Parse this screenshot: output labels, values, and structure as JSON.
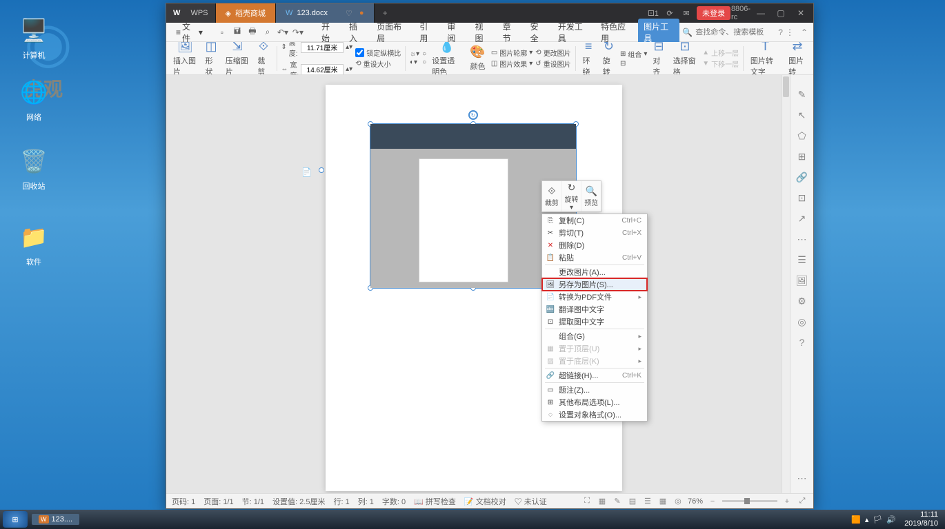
{
  "desktop": {
    "icons": {
      "computer": "计算机",
      "network": "网络",
      "recycle": "回收站",
      "software": "软件"
    },
    "watermark_text": "虎观"
  },
  "taskbar": {
    "app": "123....",
    "time": "11:11",
    "date": "2019/8/10"
  },
  "titlebar": {
    "wps": "WPS",
    "tab_store": "稻壳商城",
    "tab_doc": "123.docx",
    "login": "未登录",
    "version": "8806-rc"
  },
  "menubar": {
    "file": "文件",
    "search_placeholder": "查找命令、搜索模板",
    "tabs": [
      "开始",
      "插入",
      "页面布局",
      "引用",
      "审阅",
      "视图",
      "章节",
      "安全",
      "开发工具",
      "特色应用",
      "图片工具"
    ]
  },
  "ribbon": {
    "insert_img": "插入图片",
    "shape": "形状",
    "compress": "压缩图片",
    "crop": "裁剪",
    "height_lbl": "高度:",
    "height_val": "11.71厘米",
    "width_lbl": "宽度:",
    "width_val": "14.62厘米",
    "lock_ratio": "锁定纵横比",
    "reset_size": "重设大小",
    "set_transparent": "设置透明色",
    "color": "颜色",
    "pic_outline": "图片轮廓",
    "pic_effect": "图片效果",
    "change_pic": "更改图片",
    "reset_pic": "重设图片",
    "wrap": "环绕",
    "rotate": "旋转",
    "combo": "组合",
    "align": "对齐",
    "select_pane": "选择窗格",
    "up_layer": "上移一层",
    "down_layer": "下移一层",
    "pic_to_text": "图片转文字",
    "pic_trans": "图片转"
  },
  "mini_toolbar": {
    "crop": "裁剪",
    "rotate": "旋转",
    "preview": "预览"
  },
  "context_menu": [
    {
      "label": "复制(C)",
      "shortcut": "Ctrl+C",
      "icon": "⎘"
    },
    {
      "label": "剪切(T)",
      "shortcut": "Ctrl+X",
      "icon": "✂"
    },
    {
      "label": "删除(D)",
      "icon": "✕",
      "red": true
    },
    {
      "label": "粘贴",
      "shortcut": "Ctrl+V",
      "icon": "📋"
    },
    {
      "sep": true
    },
    {
      "label": "更改图片(A)..."
    },
    {
      "label": "另存为图片(S)...",
      "highlighted": true,
      "hover": true,
      "icon": "🖼"
    },
    {
      "label": "转换为PDF文件",
      "arrow": true,
      "icon": "📄"
    },
    {
      "label": "翻译图中文字",
      "icon": "🔤"
    },
    {
      "label": "提取图中文字",
      "icon": "⊡"
    },
    {
      "sep": true
    },
    {
      "label": "组合(G)",
      "arrow": true
    },
    {
      "label": "置于顶层(U)",
      "arrow": true,
      "disabled": true,
      "icon": "▦"
    },
    {
      "label": "置于底层(K)",
      "arrow": true,
      "disabled": true,
      "icon": "▨"
    },
    {
      "sep": true
    },
    {
      "label": "超链接(H)...",
      "shortcut": "Ctrl+K",
      "icon": "🔗"
    },
    {
      "sep": true
    },
    {
      "label": "题注(Z)...",
      "icon": "▭"
    },
    {
      "label": "其他布局选项(L)...",
      "icon": "⊞"
    },
    {
      "label": "设置对象格式(O)...",
      "icon": "◌"
    }
  ],
  "statusbar": {
    "page": "页码: 1",
    "pages": "页面: 1/1",
    "section": "节: 1/1",
    "set_val": "设置值: 2.5厘米",
    "row": "行: 1",
    "col": "列: 1",
    "chars": "字数: 0",
    "spellcheck": "拼写检查",
    "doccheck": "文档校对",
    "unverified": "未认证",
    "zoom": "76%"
  }
}
